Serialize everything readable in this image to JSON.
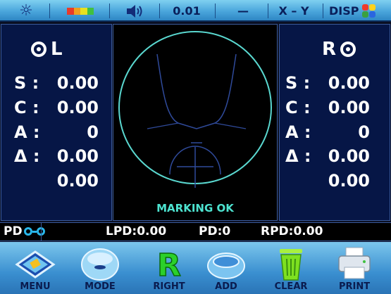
{
  "status_bar": {
    "brightness_icon": "sun-icon",
    "battery_colors": [
      "#e83a2a",
      "#f0a020",
      "#e8e020",
      "#40c040"
    ],
    "sound_icon": "speaker-icon",
    "step_value": "0.01",
    "dash_label": "—",
    "xy_label": "X – Y",
    "disp_label": "DISP",
    "disp_colors": [
      "#f03a2a",
      "#ffd21e",
      "#3aa040",
      "#2a66e0"
    ]
  },
  "left_lens": {
    "label": "L",
    "rows": [
      {
        "label": "S :",
        "value": "0.00"
      },
      {
        "label": "C :",
        "value": "0.00"
      },
      {
        "label": "A :",
        "value": "0"
      },
      {
        "label": "Δ :",
        "value": "0.00"
      },
      {
        "label": "",
        "value": "0.00"
      }
    ]
  },
  "right_lens": {
    "label": "R",
    "rows": [
      {
        "label": "S :",
        "value": "0.00"
      },
      {
        "label": "C :",
        "value": "0.00"
      },
      {
        "label": "A :",
        "value": "0"
      },
      {
        "label": "Δ :",
        "value": "0.00"
      },
      {
        "label": "",
        "value": "0.00"
      }
    ]
  },
  "center": {
    "status_text": "MARKING OK",
    "accent": "#4de3d0"
  },
  "pd_bar": {
    "label": "PD",
    "lpd": "LPD:0.00",
    "pd": "PD:0",
    "rpd": "RPD:0.00"
  },
  "toolbar": {
    "buttons": [
      {
        "label": "MENU",
        "icon": "menu-icon"
      },
      {
        "label": "MODE",
        "icon": "mode-icon"
      },
      {
        "label": "RIGHT",
        "icon": "right-icon"
      },
      {
        "label": "ADD",
        "icon": "add-icon"
      },
      {
        "label": "CLEAR",
        "icon": "clear-icon"
      },
      {
        "label": "PRINT",
        "icon": "print-icon"
      }
    ]
  }
}
